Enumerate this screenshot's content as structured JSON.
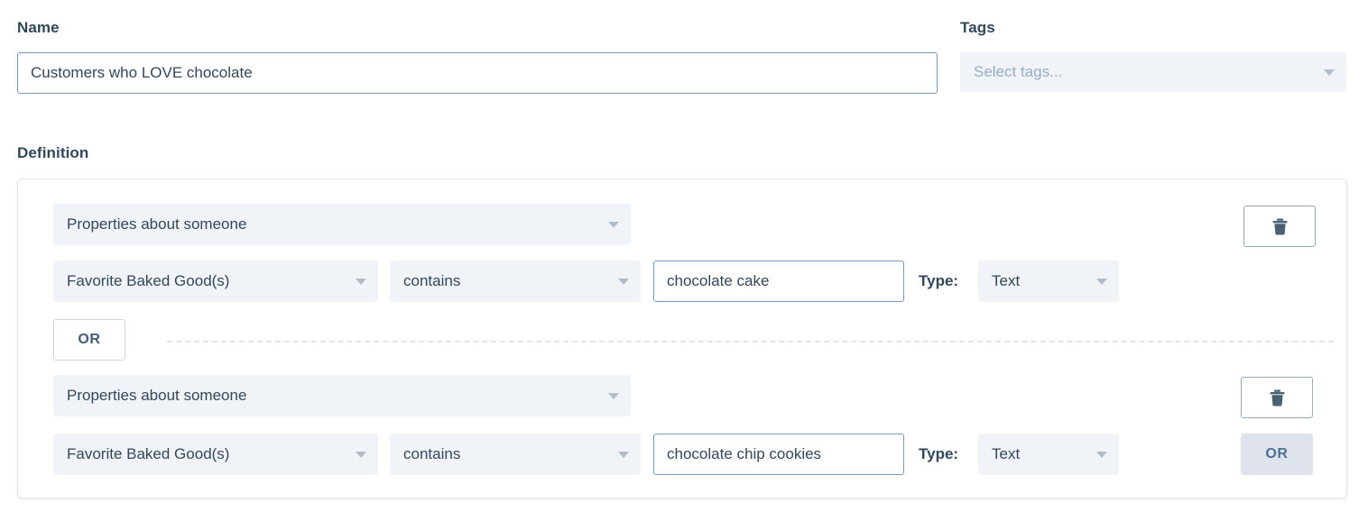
{
  "form": {
    "name_label": "Name",
    "name_value": "Customers who LOVE chocolate",
    "tags_label": "Tags",
    "tags_placeholder": "Select tags...",
    "definition_label": "Definition"
  },
  "definition": {
    "groups": [
      {
        "source": "Properties about someone",
        "property": "Favorite Baked Good(s)",
        "operator": "contains",
        "value": "chocolate cake",
        "type_label": "Type:",
        "type_value": "Text",
        "delete_icon": "trash-icon",
        "join_label": "OR"
      },
      {
        "source": "Properties about someone",
        "property": "Favorite Baked Good(s)",
        "operator": "contains",
        "value": "chocolate chip cookies",
        "type_label": "Type:",
        "type_value": "Text",
        "delete_icon": "trash-icon",
        "join_label": "OR"
      }
    ]
  },
  "colors": {
    "text": "#33475b",
    "field_bg": "#f0f3f7",
    "input_border": "#7c98b6",
    "panel_border": "#e5e8ed",
    "caret": "#b0bcc8",
    "or_filled_bg": "#dfe3eb",
    "placeholder": "#99acc2"
  }
}
